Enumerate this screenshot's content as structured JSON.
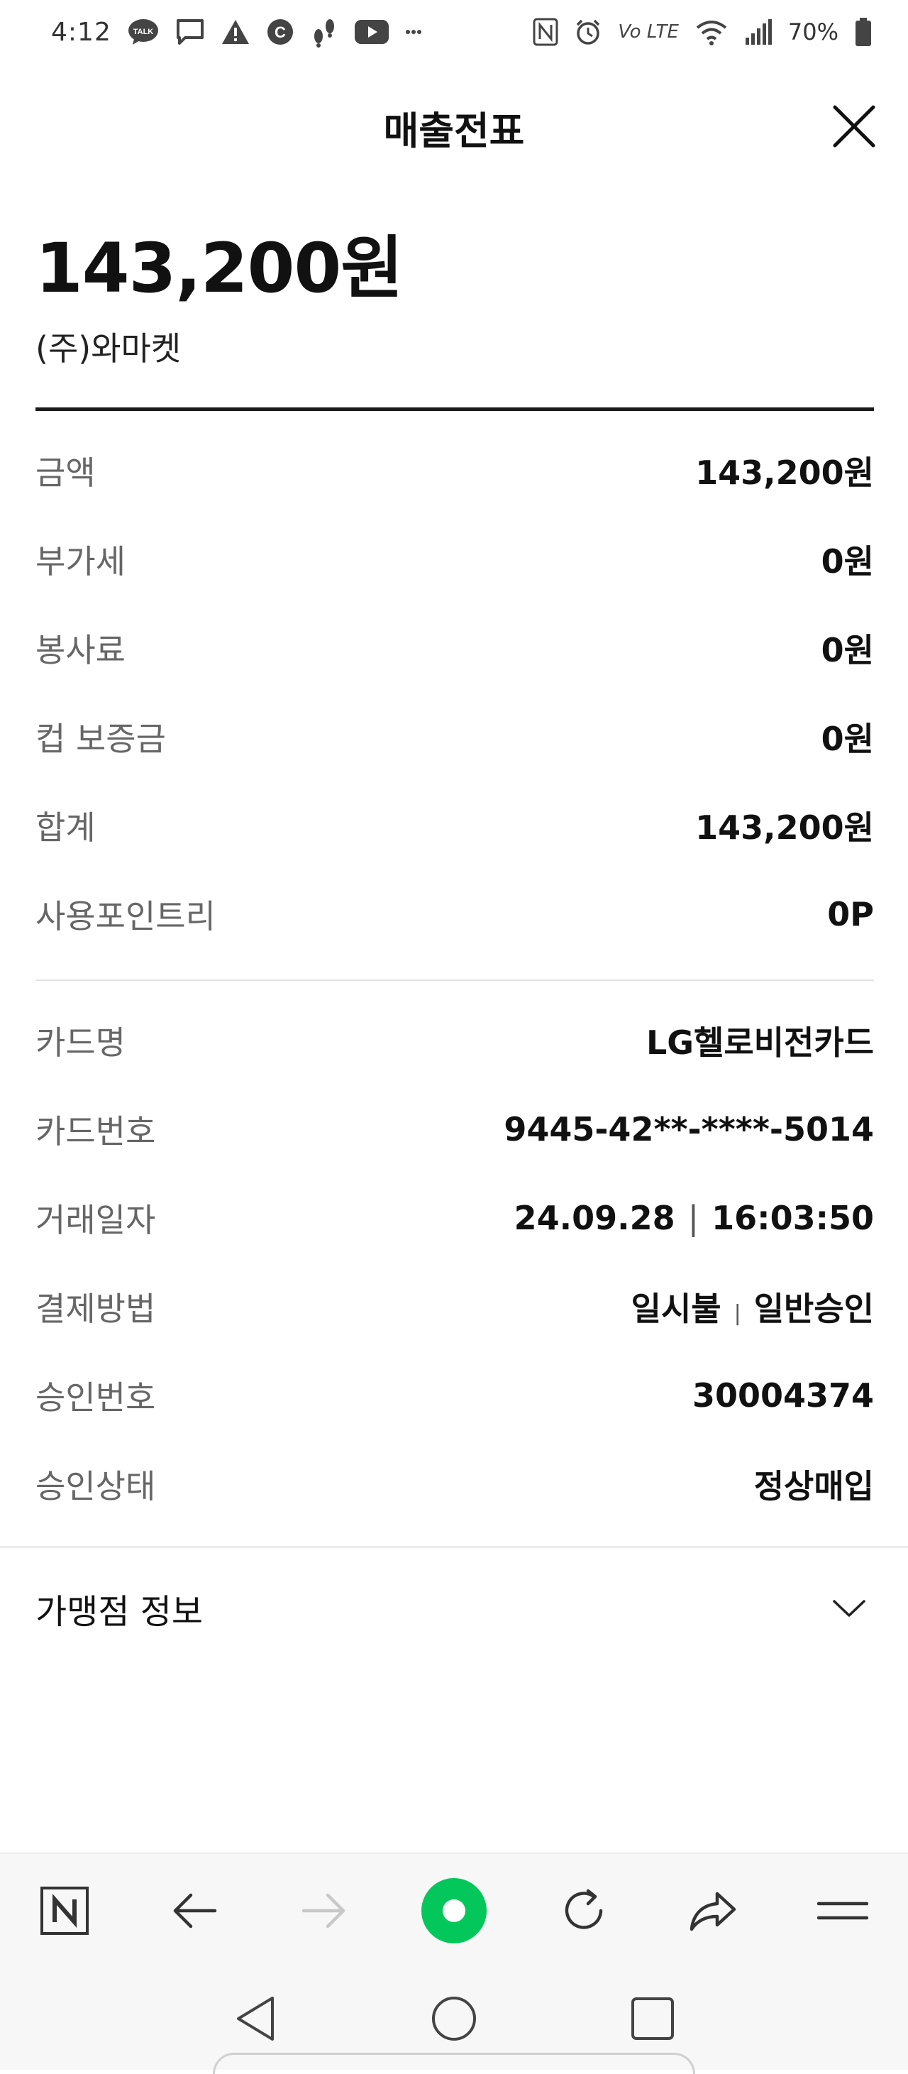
{
  "status_bar": {
    "time": "4:12",
    "lte_label": "Vo LTE",
    "battery_percent": "70%",
    "notification_icons": [
      "talk-icon",
      "message-icon",
      "warning-icon",
      "c-icon",
      "footsteps-icon",
      "youtube-icon",
      "more-icon"
    ],
    "system_icons": [
      "nfc-icon",
      "alarm-icon",
      "wifi-icon",
      "signal-icon",
      "battery-icon"
    ]
  },
  "header": {
    "title": "매출전표",
    "close_icon": "close-icon"
  },
  "summary": {
    "amount": "143,200원",
    "merchant": "(주)와마켓"
  },
  "details": [
    {
      "label": "금액",
      "value": "143,200원"
    },
    {
      "label": "부가세",
      "value": "0원"
    },
    {
      "label": "봉사료",
      "value": "0원"
    },
    {
      "label": "컵 보증금",
      "value": "0원"
    },
    {
      "label": "합계",
      "value": "143,200원"
    },
    {
      "label": "사용포인트리",
      "value": "0P"
    }
  ],
  "card_info": {
    "card_name": {
      "label": "카드명",
      "value": "LG헬로비전카드"
    },
    "card_number": {
      "label": "카드번호",
      "value": "9445-42**-****-5014"
    },
    "transaction_date": {
      "label": "거래일자",
      "date": "24.09.28",
      "time": "16:03:50"
    },
    "payment_method": {
      "label": "결제방법",
      "type": "일시불",
      "approval_type": "일반승인"
    },
    "approval_number": {
      "label": "승인번호",
      "value": "30004374"
    },
    "approval_status": {
      "label": "승인상태",
      "value": "정상매입"
    }
  },
  "merchant_info": {
    "label": "가맹점 정보",
    "icon": "chevron-down-icon"
  },
  "browser_toolbar": {
    "items": [
      "naver-n-icon",
      "back-arrow-icon",
      "forward-arrow-icon",
      "green-dot-icon",
      "refresh-icon",
      "share-icon",
      "menu-icon"
    ],
    "accent": "#03c75a"
  },
  "nav_bar": {
    "items": [
      "back-triangle-icon",
      "home-circle-icon",
      "recents-square-icon"
    ]
  }
}
